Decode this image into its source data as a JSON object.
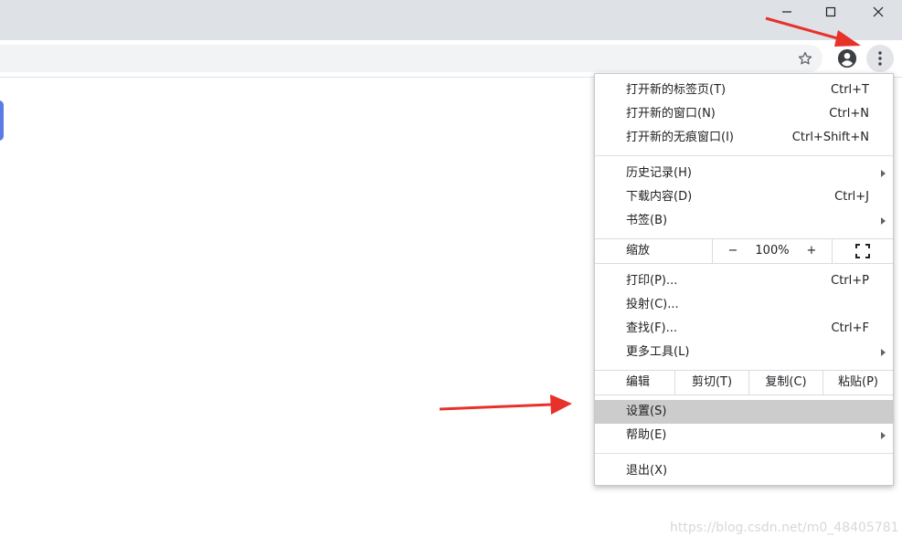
{
  "colors": {
    "titlebar_bg": "#dee1e6",
    "omnibox_bg": "#f1f3f4",
    "selected_bg": "#cccccc",
    "annotation_arrow": "#e8312b",
    "left_tab_accent": "#5b7be6"
  },
  "window_controls": {
    "minimize_icon": "minimize-icon",
    "maximize_icon": "maximize-icon",
    "close_icon": "close-icon"
  },
  "toolbar": {
    "bookmark_icon": "star-icon",
    "profile_icon": "account-circle-icon",
    "menu_icon": "kebab-menu-icon"
  },
  "menu": {
    "group1": [
      {
        "label": "打开新的标签页(T)",
        "shortcut": "Ctrl+T"
      },
      {
        "label": "打开新的窗口(N)",
        "shortcut": "Ctrl+N"
      },
      {
        "label": "打开新的无痕窗口(I)",
        "shortcut": "Ctrl+Shift+N"
      }
    ],
    "group2": [
      {
        "label": "历史记录(H)",
        "shortcut": "",
        "submenu": true
      },
      {
        "label": "下载内容(D)",
        "shortcut": "Ctrl+J"
      },
      {
        "label": "书签(B)",
        "shortcut": "",
        "submenu": true
      }
    ],
    "zoom": {
      "label": "缩放",
      "minus": "−",
      "value": "100%",
      "plus": "+",
      "fullscreen_icon": "fullscreen-icon"
    },
    "group3": [
      {
        "label": "打印(P)...",
        "shortcut": "Ctrl+P"
      },
      {
        "label": "投射(C)...",
        "shortcut": ""
      },
      {
        "label": "查找(F)...",
        "shortcut": "Ctrl+F"
      },
      {
        "label": "更多工具(L)",
        "shortcut": "",
        "submenu": true
      }
    ],
    "edit": {
      "label": "编辑",
      "cut": "剪切(T)",
      "copy": "复制(C)",
      "paste": "粘贴(P)"
    },
    "group4": [
      {
        "label": "设置(S)",
        "shortcut": "",
        "selected": true
      },
      {
        "label": "帮助(E)",
        "shortcut": "",
        "submenu": true
      }
    ],
    "group5": [
      {
        "label": "退出(X)",
        "shortcut": ""
      }
    ]
  },
  "watermark": "https://blog.csdn.net/m0_48405781"
}
